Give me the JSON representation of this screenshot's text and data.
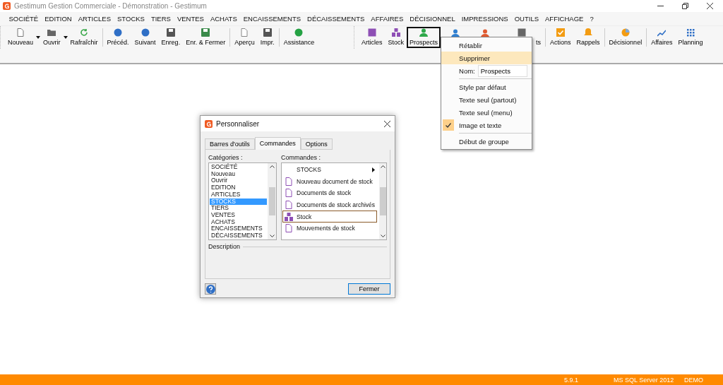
{
  "window": {
    "title": "Gestimum Gestion Commerciale - Démonstration - Gestimum"
  },
  "menu_bar": [
    "SOCIÉTÉ",
    "EDITION",
    "ARTICLES",
    "STOCKS",
    "TIERS",
    "VENTES",
    "ACHATS",
    "ENCAISSEMENTS",
    "DÉCAISSEMENTS",
    "AFFAIRES",
    "DÉCISIONNEL",
    "IMPRESSIONS",
    "OUTILS",
    "AFFICHAGE",
    "?"
  ],
  "toolbar_main": [
    {
      "items": [
        {
          "label": "Nouveau",
          "kind": "split",
          "selected": false
        },
        {
          "label": "Ouvrir",
          "kind": "split",
          "selected": false
        },
        {
          "label": "Rafraîchir",
          "kind": "button",
          "selected": false
        }
      ]
    },
    {
      "items": [
        {
          "label": "Précéd.",
          "kind": "button",
          "selected": false
        },
        {
          "label": "Suivant",
          "kind": "button",
          "selected": false
        },
        {
          "label": "Enreg.",
          "kind": "button",
          "selected": false
        },
        {
          "label": "Enr. & Fermer",
          "kind": "button",
          "selected": false
        }
      ]
    },
    {
      "items": [
        {
          "label": "Aperçu",
          "kind": "button",
          "selected": false
        },
        {
          "label": "Impr.",
          "kind": "button",
          "selected": false
        }
      ]
    },
    {
      "items": [
        {
          "label": "Assistance",
          "kind": "button",
          "selected": false
        }
      ]
    }
  ],
  "toolbar_modules": [
    {
      "items": [
        {
          "label": "Articles",
          "selected": false
        },
        {
          "label": "Stock",
          "selected": false
        },
        {
          "label": "Prospects",
          "selected": true
        },
        {
          "selected": false
        },
        {
          "selected": false
        },
        {
          "label": "ts",
          "selected": false
        }
      ]
    },
    {
      "items": [
        {
          "label": "Actions",
          "selected": false
        },
        {
          "label": "Rappels",
          "selected": false
        }
      ]
    },
    {
      "items": [
        {
          "label": "Décisionnel",
          "selected": false
        }
      ]
    },
    {
      "items": [
        {
          "label": "Affaires",
          "selected": false
        },
        {
          "label": "Planning",
          "selected": false
        }
      ]
    }
  ],
  "context_menu": [
    {
      "kind": "item",
      "label": "Rétablir",
      "selected": false,
      "checked": false
    },
    {
      "kind": "item",
      "label": "Supprimer",
      "selected": true,
      "checked": false
    },
    {
      "kind": "field",
      "label": "Nom:",
      "value": "Prospects"
    },
    {
      "kind": "separator"
    },
    {
      "kind": "item",
      "label": "Style par défaut",
      "selected": false,
      "checked": false
    },
    {
      "kind": "item",
      "label": "Texte seul (partout)",
      "selected": false,
      "checked": false
    },
    {
      "kind": "item",
      "label": "Texte seul (menu)",
      "selected": false,
      "checked": false
    },
    {
      "kind": "item",
      "label": "Image et texte",
      "selected": false,
      "checked": true
    },
    {
      "kind": "separator"
    },
    {
      "kind": "item",
      "label": "Début de groupe",
      "selected": false,
      "checked": false
    }
  ],
  "dialog": {
    "title": "Personnaliser",
    "tabs": [
      {
        "label": "Barres d'outils",
        "selected": false
      },
      {
        "label": "Commandes",
        "selected": true
      },
      {
        "label": "Options",
        "selected": false
      }
    ],
    "categories_label": "Catégories :",
    "categories": [
      {
        "label": "SOCIÉTÉ",
        "selected": false
      },
      {
        "label": "Nouveau",
        "selected": false
      },
      {
        "label": "Ouvrir",
        "selected": false
      },
      {
        "label": "EDITION",
        "selected": false
      },
      {
        "label": "ARTICLES",
        "selected": false
      },
      {
        "label": "STOCKS",
        "selected": true
      },
      {
        "label": "TIERS",
        "selected": false
      },
      {
        "label": "VENTES",
        "selected": false
      },
      {
        "label": "ACHATS",
        "selected": false
      },
      {
        "label": "ENCAISSEMENTS",
        "selected": false
      },
      {
        "label": "DÉCAISSEMENTS",
        "selected": false
      }
    ],
    "commands_label": "Commandes :",
    "commands": [
      {
        "kind": "submenu",
        "label": "STOCKS",
        "selected": false
      },
      {
        "kind": "command",
        "label": "Nouveau document de stock",
        "selected": false
      },
      {
        "kind": "command",
        "label": "Documents de stock",
        "selected": false
      },
      {
        "kind": "command",
        "label": "Documents de stock archivés",
        "selected": false
      },
      {
        "kind": "command",
        "label": "Stock",
        "selected": true
      },
      {
        "kind": "command",
        "label": "Mouvements de stock",
        "selected": false
      }
    ],
    "description_label": "Description",
    "close_button": "Fermer"
  },
  "status_bar": [
    "5.9.1",
    "MS SQL Server 2012",
    "DEMO"
  ]
}
